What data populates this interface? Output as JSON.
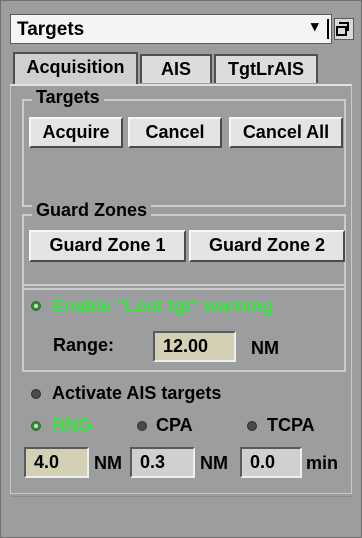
{
  "title_bar": {
    "title": "Targets",
    "dropdown_icon": "triangle-down-icon",
    "window_icon": "restore-window-icon"
  },
  "tabs": [
    {
      "label": "Acquisition",
      "active": true
    },
    {
      "label": "AIS",
      "active": false
    },
    {
      "label": "TgtLrAIS",
      "active": false
    }
  ],
  "targets_group": {
    "title": "Targets",
    "buttons": {
      "acquire": "Acquire",
      "cancel": "Cancel",
      "cancel_all": "Cancel All"
    }
  },
  "guard_zones_group": {
    "title": "Guard Zones",
    "buttons": {
      "zone1": "Guard Zone 1",
      "zone2": "Guard Zone 2"
    }
  },
  "lost_target": {
    "label": "Enable \"Lost tgt\" warning",
    "enabled": true,
    "range_label": "Range:",
    "range_value": "12.00",
    "range_unit": "NM"
  },
  "ais": {
    "activate_label": "Activate AIS targets",
    "activate_on": false,
    "modes": [
      {
        "label": "RNG",
        "selected": true
      },
      {
        "label": "CPA",
        "selected": false
      },
      {
        "label": "TCPA",
        "selected": false
      }
    ],
    "rng_value": "4.0",
    "rng_unit": "NM",
    "cpa_value": "0.3",
    "cpa_unit": "NM",
    "tcpa_value": "0.0",
    "tcpa_unit": "min"
  },
  "colors": {
    "panel_bg": "#9b9d9e",
    "active_green": "#39e53f",
    "field_bg": "#d3d0b4"
  }
}
